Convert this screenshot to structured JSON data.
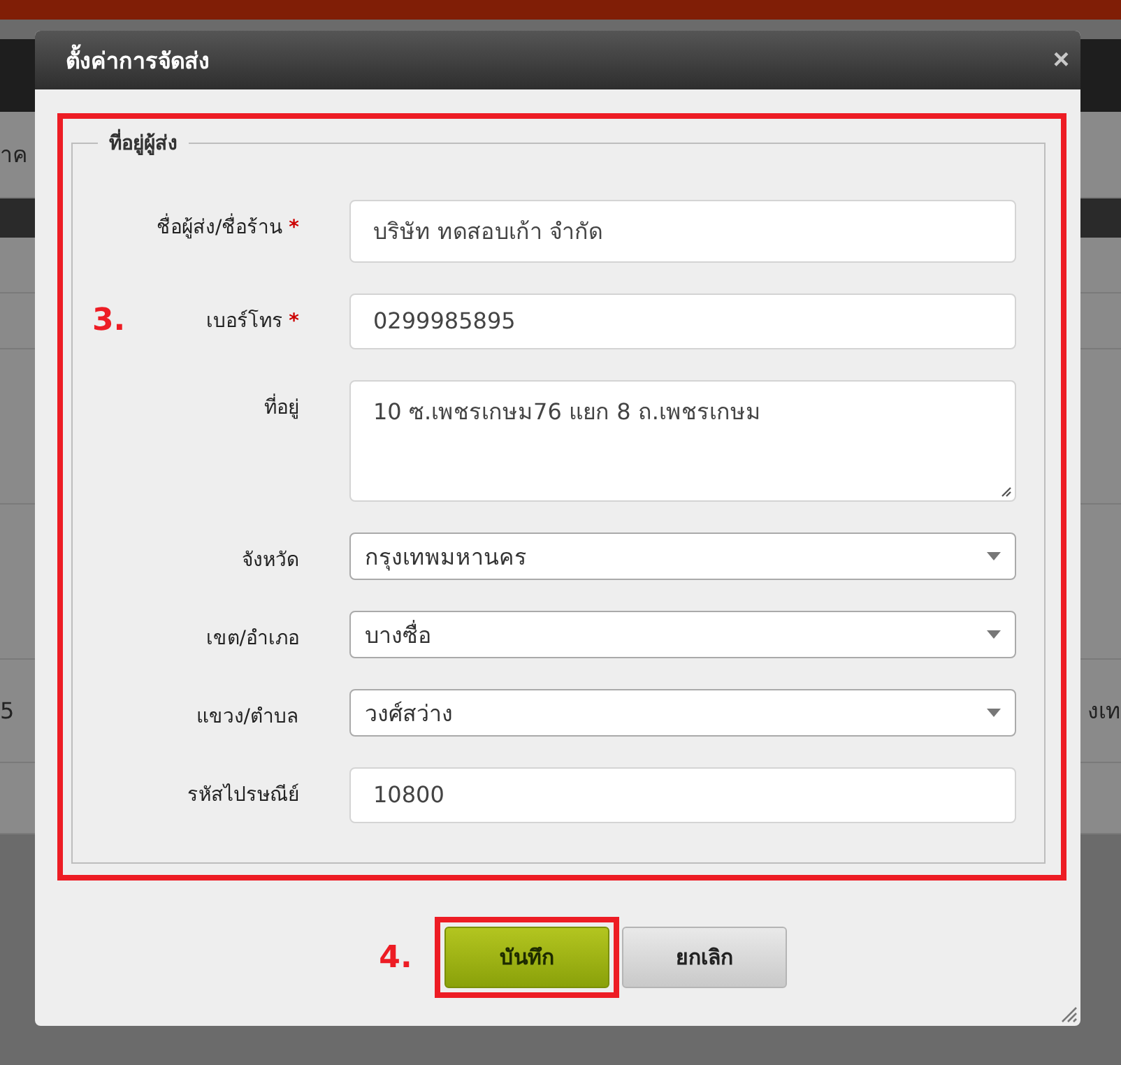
{
  "background": {
    "left_fragment": "าค",
    "row_number": "5",
    "right_fragment": "งเท"
  },
  "dialog": {
    "title": "ตั้งค่าการจัดส่ง",
    "close": "×",
    "required_mark": "*",
    "section": {
      "legend": "ที่อยู่ผู้ส่ง",
      "annotation": "3.",
      "fields": [
        {
          "kind": "input",
          "label": "ชื่อผู้ส่ง/ชื่อร้าน",
          "required": true,
          "value": "บริษัท ทดสอบเก้า จำกัด"
        },
        {
          "kind": "input",
          "label": "เบอร์โทร",
          "required": true,
          "value": "0299985895"
        },
        {
          "kind": "textarea",
          "label": "ที่อยู่",
          "required": false,
          "value": "10 ซ.เพชรเกษม76 แยก 8 ถ.เพชรเกษม"
        },
        {
          "kind": "select",
          "label": "จังหวัด",
          "required": false,
          "value": "กรุงเทพมหานคร"
        },
        {
          "kind": "select",
          "label": "เขต/อำเภอ",
          "required": false,
          "value": "บางซื่อ"
        },
        {
          "kind": "select",
          "label": "แขวง/ตำบล",
          "required": false,
          "value": "วงศ์สว่าง"
        },
        {
          "kind": "input",
          "label": "รหัสไปรษณีย์",
          "required": false,
          "value": "10800"
        }
      ]
    },
    "footer": {
      "annotation": "4.",
      "buttons": [
        {
          "kind": "primary",
          "label": "บันทึก"
        },
        {
          "kind": "secondary",
          "label": "ยกเลิก"
        }
      ]
    }
  }
}
